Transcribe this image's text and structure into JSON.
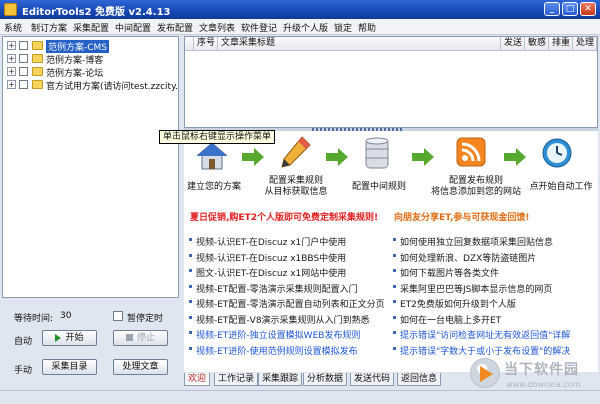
{
  "window": {
    "title": "EditorTools2 免费版 v2.4.13"
  },
  "menu": [
    "系统",
    "制订方案",
    "采集配置",
    "中间配置",
    "发布配置",
    "文章列表",
    "软件登记",
    "升级个人版",
    "锁定",
    "帮助"
  ],
  "tree": [
    {
      "label": "范例方案-CMS"
    },
    {
      "label": "范例方案-博客"
    },
    {
      "label": "范例方案-论坛"
    },
    {
      "label": "官方试用方案(请访问test.zzcity."
    }
  ],
  "controls": {
    "wait_label": "等待时间:",
    "wait_value": "30",
    "pause_label": "暂停定时",
    "auto_label": "自动",
    "start_button": "开始",
    "stop_button": "停止",
    "manual_label": "手动",
    "collect_list_button": "采集目录",
    "process_button": "处理文章"
  },
  "table": {
    "columns": [
      "序号",
      "文章采集标题",
      "发送",
      "敏感",
      "排重",
      "处理"
    ]
  },
  "tooltip": "单击鼠标右键显示操作菜单",
  "steps": [
    {
      "label": "建立您的方案",
      "icon": "home-icon"
    },
    {
      "label": "配置采集规则\n从目标获取信息",
      "icon": "pencil-icon"
    },
    {
      "label": "配置中间规则",
      "icon": "database-icon"
    },
    {
      "label": "配置发布规则\n将信息添加到您的网站",
      "icon": "rss-icon"
    },
    {
      "label": "点开始自动工作",
      "icon": "clock-icon"
    }
  ],
  "promos": {
    "left": "夏日促销,购ET2个人版即可免费定制采集规则!",
    "right": "向朋友分享ET,参与可获现金回馈!"
  },
  "links_left": [
    {
      "text": "视频-认识ET-在Discuz x1门户中使用",
      "highlight": false
    },
    {
      "text": "视频-认识ET-在Discuz x1BBS中使用",
      "highlight": false
    },
    {
      "text": "图文-认识ET-在Discuz x1网站中使用",
      "highlight": false
    },
    {
      "text": "视频-ET配置-零浩演示采集规则配置入门",
      "highlight": false
    },
    {
      "text": "视频-ET配置-零浩演示配置自动列表和正文分页",
      "highlight": false
    },
    {
      "text": "视频-ET配置-V8演示采集规则从入门到熟悉",
      "highlight": false
    },
    {
      "text": "视频-ET进阶-独立设置模拟WEB发布规则",
      "highlight": true
    },
    {
      "text": "视频-ET进阶-使用范例规则设置模拟发布",
      "highlight": true
    }
  ],
  "links_right": [
    {
      "text": "如何使用独立回复数据项采集回贴信息",
      "highlight": false
    },
    {
      "text": "如何处理新浪、DZX等防盗链图片",
      "highlight": false
    },
    {
      "text": "如何下载图片等各类文件",
      "highlight": false
    },
    {
      "text": "采集阿里巴巴等JS脚本显示信息的网页",
      "highlight": false
    },
    {
      "text": "ET2免费版如何升级到个人版",
      "highlight": false
    },
    {
      "text": "如何在一台电脑上多开ET",
      "highlight": false
    },
    {
      "text": "提示错误\"访问检查网址无有效返回值\"详解",
      "highlight": true
    },
    {
      "text": "提示错误\"字数大于或小于发布设置\"的解决",
      "highlight": true
    }
  ],
  "tabs": [
    "欢迎",
    "工作记录",
    "采集跟踪",
    "分析数据",
    "发送代码",
    "返回信息"
  ],
  "watermark": {
    "text": "当下软件园",
    "url": "www.downxia.com"
  },
  "colors": {
    "titlebar": "#1748b4",
    "promo_red": "#e02020",
    "promo_orange": "#e06a10",
    "link_blue": "#1f57d6"
  }
}
